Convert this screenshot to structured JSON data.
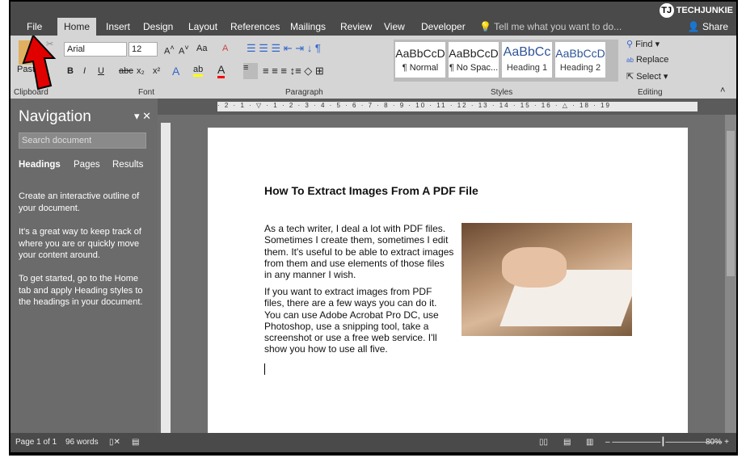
{
  "tabs": [
    "File",
    "Home",
    "Insert",
    "Design",
    "Layout",
    "References",
    "Mailings",
    "Review",
    "View",
    "Developer"
  ],
  "active_tab": "Home",
  "tell_me": "Tell me what you want to do...",
  "share": "Share",
  "logo": "TECHJUNKIE",
  "ribbon": {
    "clipboard": {
      "paste": "Paste",
      "label": "Clipboard"
    },
    "font": {
      "name": "Arial",
      "size": "12",
      "label": "Font",
      "bold": "B",
      "italic": "I",
      "underline": "U",
      "strike": "abc",
      "sub": "x₂",
      "sup": "x²",
      "case": "Aa"
    },
    "paragraph": {
      "label": "Paragraph"
    },
    "styles": {
      "label": "Styles",
      "items": [
        {
          "preview": "AaBbCcD",
          "name": "¶ Normal"
        },
        {
          "preview": "AaBbCcD",
          "name": "¶ No Spac..."
        },
        {
          "preview": "AaBbCc",
          "name": "Heading 1"
        },
        {
          "preview": "AaBbCcD",
          "name": "Heading 2"
        }
      ]
    },
    "editing": {
      "label": "Editing",
      "find": "Find",
      "replace": "Replace",
      "select": "Select"
    }
  },
  "ruler": "· 2 · 1 · ▽ · 1 · 2 · 3 · 4 · 5 · 6 · 7 · 8 · 9 · 10 · 11 · 12 · 13 · 14 · 15 · 16 · △ · 18 · 19",
  "navigation": {
    "title": "Navigation",
    "search_placeholder": "Search document",
    "tabs": [
      "Headings",
      "Pages",
      "Results"
    ],
    "paragraphs": [
      "Create an interactive outline of your document.",
      "It's a great way to keep track of where you are or quickly move your content around.",
      "To get started, go to the Home tab and apply Heading styles to the headings in your document."
    ]
  },
  "document": {
    "title": "How To Extract Images From A PDF File",
    "paragraphs": [
      "As a tech writer, I deal a lot with PDF files. Sometimes I create them, sometimes I edit them. It's useful to be able to extract images from them and use elements of those files in any manner I wish.",
      "If you want to extract images from PDF files, there are a few ways you can do it. You can use Adobe Acrobat Pro DC, use Photoshop, use a snipping tool, take a screenshot or use a free web service. I'll show you how to use all five."
    ]
  },
  "status": {
    "page": "Page 1 of 1",
    "words": "96 words",
    "zoom": "80%"
  },
  "colors": {
    "arrow": "#e00000",
    "highlight": "#ffff00",
    "font_color": "#ff0000"
  }
}
